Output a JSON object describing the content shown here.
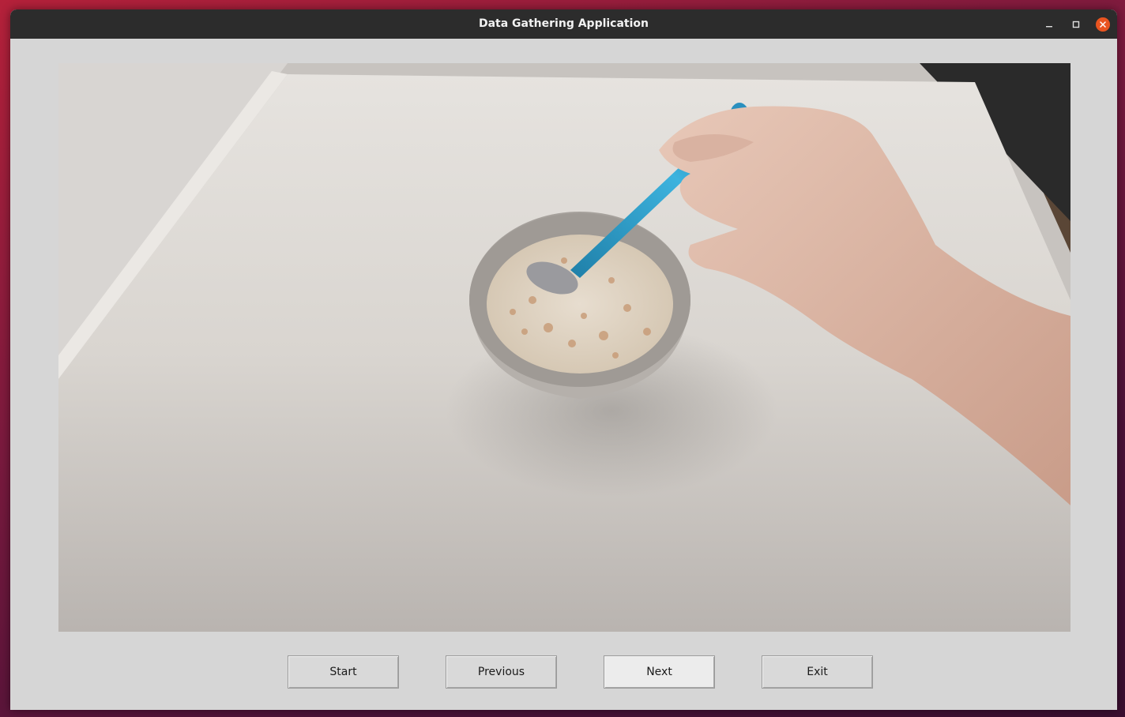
{
  "window": {
    "title": "Data Gathering Application"
  },
  "video": {
    "description_icon": "camera-frame-image"
  },
  "buttons": {
    "start": "Start",
    "previous": "Previous",
    "next": "Next",
    "exit": "Exit"
  },
  "colors": {
    "titlebar": "#2c2c2c",
    "close_button": "#e95420",
    "window_bg": "#d6d6d6"
  }
}
